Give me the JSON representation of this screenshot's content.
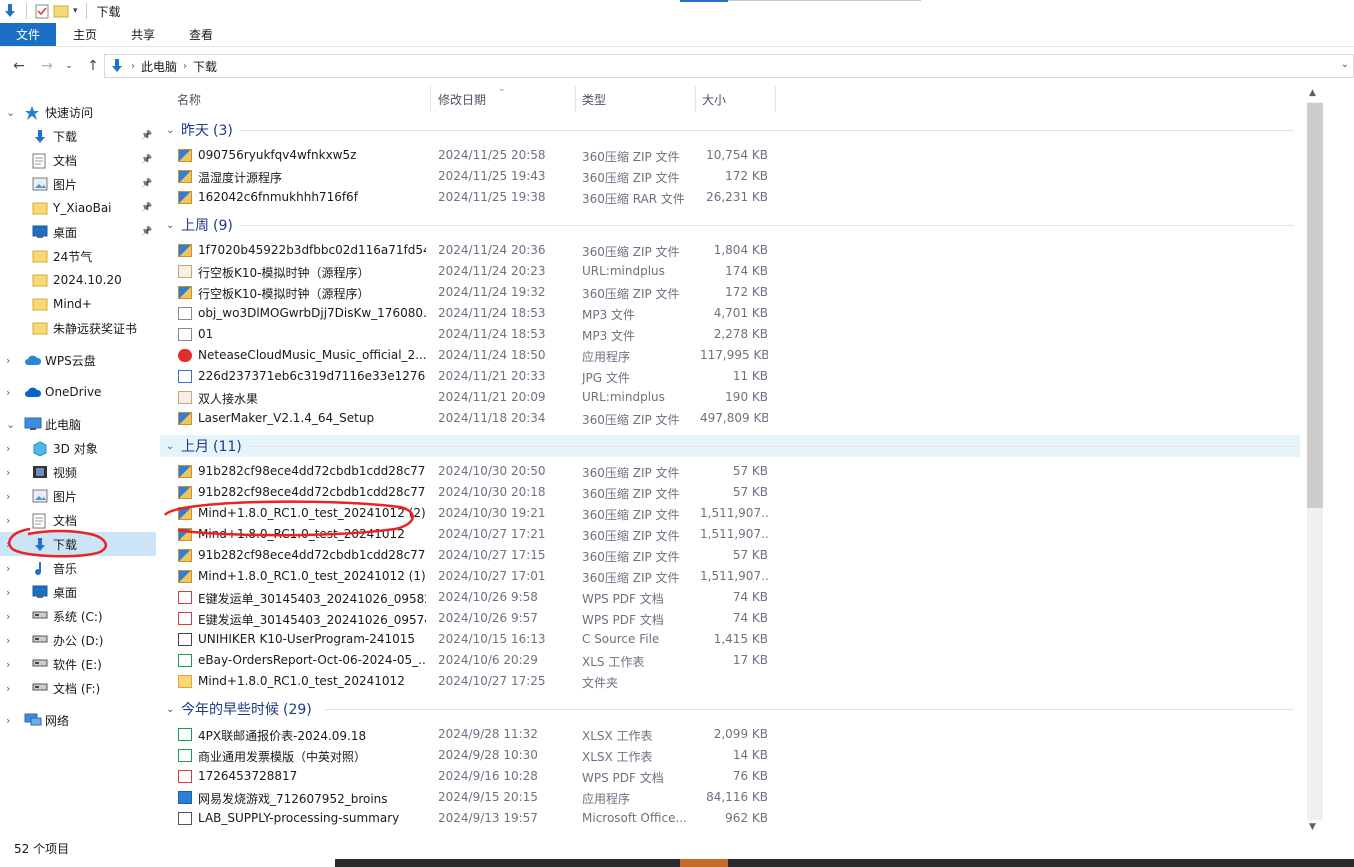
{
  "window": {
    "title": "下载"
  },
  "ribbon": {
    "tabs": [
      "文件",
      "主页",
      "共享",
      "查看"
    ]
  },
  "address": {
    "crumbs": [
      "此电脑",
      "下载"
    ]
  },
  "sidebar": {
    "quick_access": "快速访问",
    "items": [
      {
        "label": "下载",
        "icon": "download-arrow-icon",
        "pinned": true
      },
      {
        "label": "文档",
        "icon": "document-icon",
        "pinned": true
      },
      {
        "label": "图片",
        "icon": "pictures-icon",
        "pinned": true
      },
      {
        "label": "Y_XiaoBai",
        "icon": "folder-icon",
        "pinned": true
      },
      {
        "label": "桌面",
        "icon": "desktop-icon",
        "pinned": true
      },
      {
        "label": "24节气",
        "icon": "folder-icon",
        "pinned": false
      },
      {
        "label": "2024.10.20",
        "icon": "folder-icon",
        "pinned": false
      },
      {
        "label": "Mind+",
        "icon": "folder-icon",
        "pinned": false
      },
      {
        "label": "朱静远获奖证书",
        "icon": "folder-icon",
        "pinned": false
      }
    ],
    "wps": "WPS云盘",
    "onedrive": "OneDrive",
    "this_pc": "此电脑",
    "pc_items": [
      {
        "label": "3D 对象",
        "icon": "3d-objects-icon"
      },
      {
        "label": "视频",
        "icon": "videos-icon"
      },
      {
        "label": "图片",
        "icon": "pictures-icon"
      },
      {
        "label": "文档",
        "icon": "document-icon"
      },
      {
        "label": "下载",
        "icon": "download-arrow-icon",
        "selected": true
      },
      {
        "label": "音乐",
        "icon": "music-icon"
      },
      {
        "label": "桌面",
        "icon": "desktop-icon"
      },
      {
        "label": "系统 (C:)",
        "icon": "drive-icon"
      },
      {
        "label": "办公 (D:)",
        "icon": "drive-icon"
      },
      {
        "label": "软件 (E:)",
        "icon": "drive-icon"
      },
      {
        "label": "文档 (F:)",
        "icon": "drive-icon"
      }
    ],
    "network": "网络"
  },
  "columns": {
    "name": "名称",
    "modified": "修改日期",
    "type": "类型",
    "size": "大小"
  },
  "groups": [
    {
      "title": "昨天",
      "count": "(3)",
      "rows": [
        {
          "name": "090756ryukfqv4wfnkxw5z",
          "date": "2024/11/25 20:58",
          "type": "360压缩 ZIP 文件",
          "size": "10,754 KB",
          "icon": "zip"
        },
        {
          "name": "温湿度计源程序",
          "date": "2024/11/25 19:43",
          "type": "360压缩 ZIP 文件",
          "size": "172 KB",
          "icon": "zip"
        },
        {
          "name": "162042c6fnmukhhh716f6f",
          "date": "2024/11/25 19:38",
          "type": "360压缩 RAR 文件",
          "size": "26,231 KB",
          "icon": "zip"
        }
      ]
    },
    {
      "title": "上周",
      "count": "(9)",
      "rows": [
        {
          "name": "1f7020b45922b3dfbbc02d116a71fd54",
          "date": "2024/11/24 20:36",
          "type": "360压缩 ZIP 文件",
          "size": "1,804 KB",
          "icon": "zip"
        },
        {
          "name": "行空板K10-模拟时钟（源程序）",
          "date": "2024/11/24 20:23",
          "type": "URL:mindplus",
          "size": "174 KB",
          "icon": "url"
        },
        {
          "name": "行空板K10-模拟时钟（源程序）",
          "date": "2024/11/24 19:32",
          "type": "360压缩 ZIP 文件",
          "size": "172 KB",
          "icon": "zip"
        },
        {
          "name": "obj_wo3DlMOGwrbDjj7DisKw_176080...",
          "date": "2024/11/24 18:53",
          "type": "MP3 文件",
          "size": "4,701 KB",
          "icon": "mp3"
        },
        {
          "name": "01",
          "date": "2024/11/24 18:53",
          "type": "MP3 文件",
          "size": "2,278 KB",
          "icon": "mp3"
        },
        {
          "name": "NeteaseCloudMusic_Music_official_2....",
          "date": "2024/11/24 18:50",
          "type": "应用程序",
          "size": "117,995 KB",
          "icon": "app163"
        },
        {
          "name": "226d237371eb6c319d7116e33e1276...",
          "date": "2024/11/21 20:33",
          "type": "JPG 文件",
          "size": "11 KB",
          "icon": "jpg"
        },
        {
          "name": "双人接水果",
          "date": "2024/11/21 20:09",
          "type": "URL:mindplus",
          "size": "190 KB",
          "icon": "url"
        },
        {
          "name": "LaserMaker_V2.1.4_64_Setup",
          "date": "2024/11/18 20:34",
          "type": "360压缩 ZIP 文件",
          "size": "497,809 KB",
          "icon": "zip"
        }
      ]
    },
    {
      "title": "上月",
      "count": "(11)",
      "rows": [
        {
          "name": "91b282cf98ece4dd72cbdb1cdd28c77...",
          "date": "2024/10/30 20:50",
          "type": "360压缩 ZIP 文件",
          "size": "57 KB",
          "icon": "zip"
        },
        {
          "name": "91b282cf98ece4dd72cbdb1cdd28c77...",
          "date": "2024/10/30 20:18",
          "type": "360压缩 ZIP 文件",
          "size": "57 KB",
          "icon": "zip"
        },
        {
          "name": "Mind+1.8.0_RC1.0_test_20241012 (2)",
          "date": "2024/10/30 19:21",
          "type": "360压缩 ZIP 文件",
          "size": "1,511,907...",
          "icon": "zip"
        },
        {
          "name": "Mind+1.8.0_RC1.0_test_20241012",
          "date": "2024/10/27 17:21",
          "type": "360压缩 ZIP 文件",
          "size": "1,511,907...",
          "icon": "zip"
        },
        {
          "name": "91b282cf98ece4dd72cbdb1cdd28c777",
          "date": "2024/10/27 17:15",
          "type": "360压缩 ZIP 文件",
          "size": "57 KB",
          "icon": "zip"
        },
        {
          "name": "Mind+1.8.0_RC1.0_test_20241012 (1)",
          "date": "2024/10/27 17:01",
          "type": "360压缩 ZIP 文件",
          "size": "1,511,907...",
          "icon": "zip"
        },
        {
          "name": "E键发运单_30145403_20241026_095825",
          "date": "2024/10/26 9:58",
          "type": "WPS PDF 文档",
          "size": "74 KB",
          "icon": "pdf"
        },
        {
          "name": "E键发运单_30145403_20241026_095749",
          "date": "2024/10/26 9:57",
          "type": "WPS PDF 文档",
          "size": "74 KB",
          "icon": "pdf"
        },
        {
          "name": "UNIHIKER K10-UserProgram-241015",
          "date": "2024/10/15 16:13",
          "type": "C Source File",
          "size": "1,415 KB",
          "icon": "csrc"
        },
        {
          "name": "eBay-OrdersReport-Oct-06-2024-05_...",
          "date": "2024/10/6 20:29",
          "type": "XLS 工作表",
          "size": "17 KB",
          "icon": "xls"
        },
        {
          "name": "Mind+1.8.0_RC1.0_test_20241012",
          "date": "2024/10/27 17:25",
          "type": "文件夹",
          "size": "",
          "icon": "fold"
        }
      ]
    },
    {
      "title": "今年的早些时候",
      "count": "(29)",
      "rows": [
        {
          "name": "4PX联邮通报价表-2024.09.18",
          "date": "2024/9/28 11:32",
          "type": "XLSX 工作表",
          "size": "2,099 KB",
          "icon": "xls"
        },
        {
          "name": "商业通用发票模版（中英对照）",
          "date": "2024/9/28 10:30",
          "type": "XLSX 工作表",
          "size": "14 KB",
          "icon": "xls"
        },
        {
          "name": "1726453728817",
          "date": "2024/9/16 10:28",
          "type": "WPS PDF 文档",
          "size": "76 KB",
          "icon": "pdf"
        },
        {
          "name": "网易发烧游戏_712607952_broins",
          "date": "2024/9/15 20:15",
          "type": "应用程序",
          "size": "84,116 KB",
          "icon": "cube"
        },
        {
          "name": "LAB_SUPPLY-processing-summary",
          "date": "2024/9/13 19:57",
          "type": "Microsoft Office...",
          "size": "962 KB",
          "icon": "doc"
        }
      ]
    }
  ],
  "status": {
    "count": "52 个项目"
  }
}
